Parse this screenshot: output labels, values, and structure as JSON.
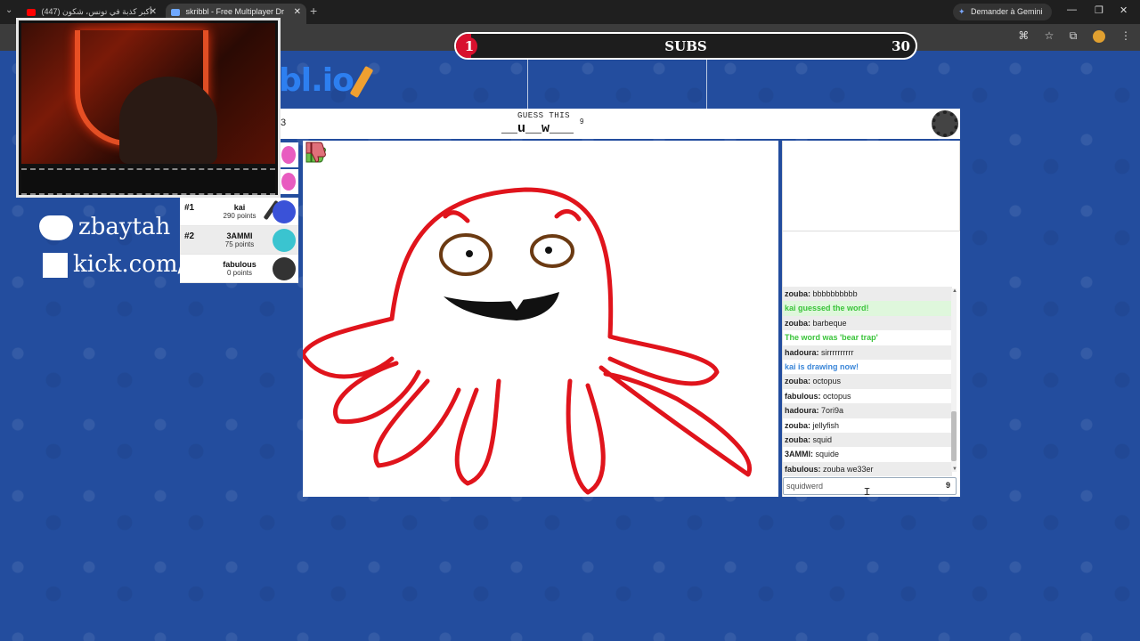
{
  "browser": {
    "tabs": [
      {
        "label": "(447) أكبر كذبة في تونس، شكون",
        "favicon_color": "#ff0000"
      },
      {
        "label": "skribbl - Free Multiplayer Dr",
        "favicon_color": "#6fa8ff"
      }
    ],
    "gemini_button": "Demander à Gemini"
  },
  "subs_goal": {
    "current": "1",
    "title": "SUBS",
    "target": "30",
    "progress_fraction": 0.033
  },
  "logo": {
    "text": "bl.io"
  },
  "game": {
    "round_fragment": "3",
    "guess_label": "GUESS THIS",
    "word_hint": "__u__w___",
    "word_length": "9"
  },
  "players": [
    {
      "rank": "#1",
      "name": "kai",
      "points": "290 points",
      "avatar_color": "#3a52d8",
      "drawing": true
    },
    {
      "rank": "#2",
      "name": "3AMMI",
      "points": "75 points",
      "avatar_color": "#3ac4d0",
      "drawing": false
    },
    {
      "rank": "",
      "name": "fabulous",
      "points": "0 points",
      "avatar_color": "#333333",
      "drawing": false
    }
  ],
  "chat": {
    "messages": [
      {
        "user": "zouba:",
        "text": "bbbbbbbbbb",
        "style": "normal"
      },
      {
        "user": "",
        "text": "kai guessed the word!",
        "style": "greenbg"
      },
      {
        "user": "zouba:",
        "text": "barbeque",
        "style": "normal"
      },
      {
        "user": "",
        "text": "The word was 'bear trap'",
        "style": "green"
      },
      {
        "user": "hadoura:",
        "text": "sirrrrrrrrrr",
        "style": "normal"
      },
      {
        "user": "",
        "text": "kai is drawing now!",
        "style": "blue"
      },
      {
        "user": "zouba:",
        "text": "octopus",
        "style": "normal"
      },
      {
        "user": "fabulous:",
        "text": "octopus",
        "style": "normal"
      },
      {
        "user": "hadoura:",
        "text": "7ori9a",
        "style": "normal"
      },
      {
        "user": "zouba:",
        "text": "jellyfish",
        "style": "normal"
      },
      {
        "user": "zouba:",
        "text": "squid",
        "style": "normal"
      },
      {
        "user": "3AMMI:",
        "text": "squide",
        "style": "normal"
      },
      {
        "user": "fabulous:",
        "text": "zouba we33er",
        "style": "normal"
      }
    ],
    "input_value": "squidwerd",
    "input_count": "9"
  },
  "socials": {
    "discord": "zbaytah",
    "kick": "kick.com/zbaytah"
  },
  "colors": {
    "page_bg": "#234d9e",
    "accent_red": "#d8102e",
    "guess_green": "#3bc43b",
    "info_blue": "#3a86d8"
  }
}
